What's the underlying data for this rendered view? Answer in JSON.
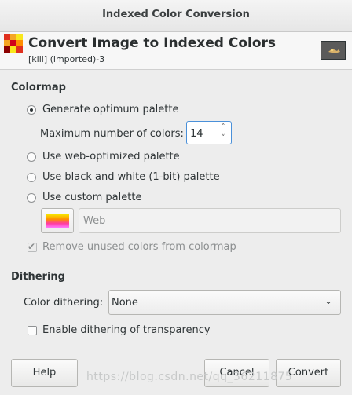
{
  "window": {
    "title": "Indexed Color Conversion"
  },
  "header": {
    "title": "Convert Image to Indexed Colors",
    "subtitle": "[kill] (imported)-3"
  },
  "colormap": {
    "section_label": "Colormap",
    "generate_optimum": "Generate optimum palette",
    "max_colors_label": "Maximum number of colors:",
    "max_colors_value": "14",
    "web_optimized": "Use web-optimized palette",
    "black_white": "Use black and white (1-bit) palette",
    "custom_palette": "Use custom palette",
    "custom_palette_name": "Web",
    "remove_unused": "Remove unused colors from colormap",
    "selected": "Generate optimum palette"
  },
  "dithering": {
    "section_label": "Dithering",
    "color_dithering_label": "Color dithering:",
    "color_dithering_value": "None",
    "transparency_label": "Enable dithering of transparency"
  },
  "buttons": {
    "help": "Help",
    "cancel": "Cancel",
    "convert": "Convert"
  },
  "watermark": "https://blog.csdn.net/qq_36211875",
  "icons": {
    "app": "gimp-indexed-icon",
    "thumbnail": "image-thumbnail",
    "spin_up": "chevron-up-icon",
    "spin_down": "chevron-down-icon",
    "combo_arrow": "chevron-down-icon",
    "check": "check-icon"
  },
  "colors": {
    "focus": "#4a90d9",
    "background": "#ededed"
  }
}
